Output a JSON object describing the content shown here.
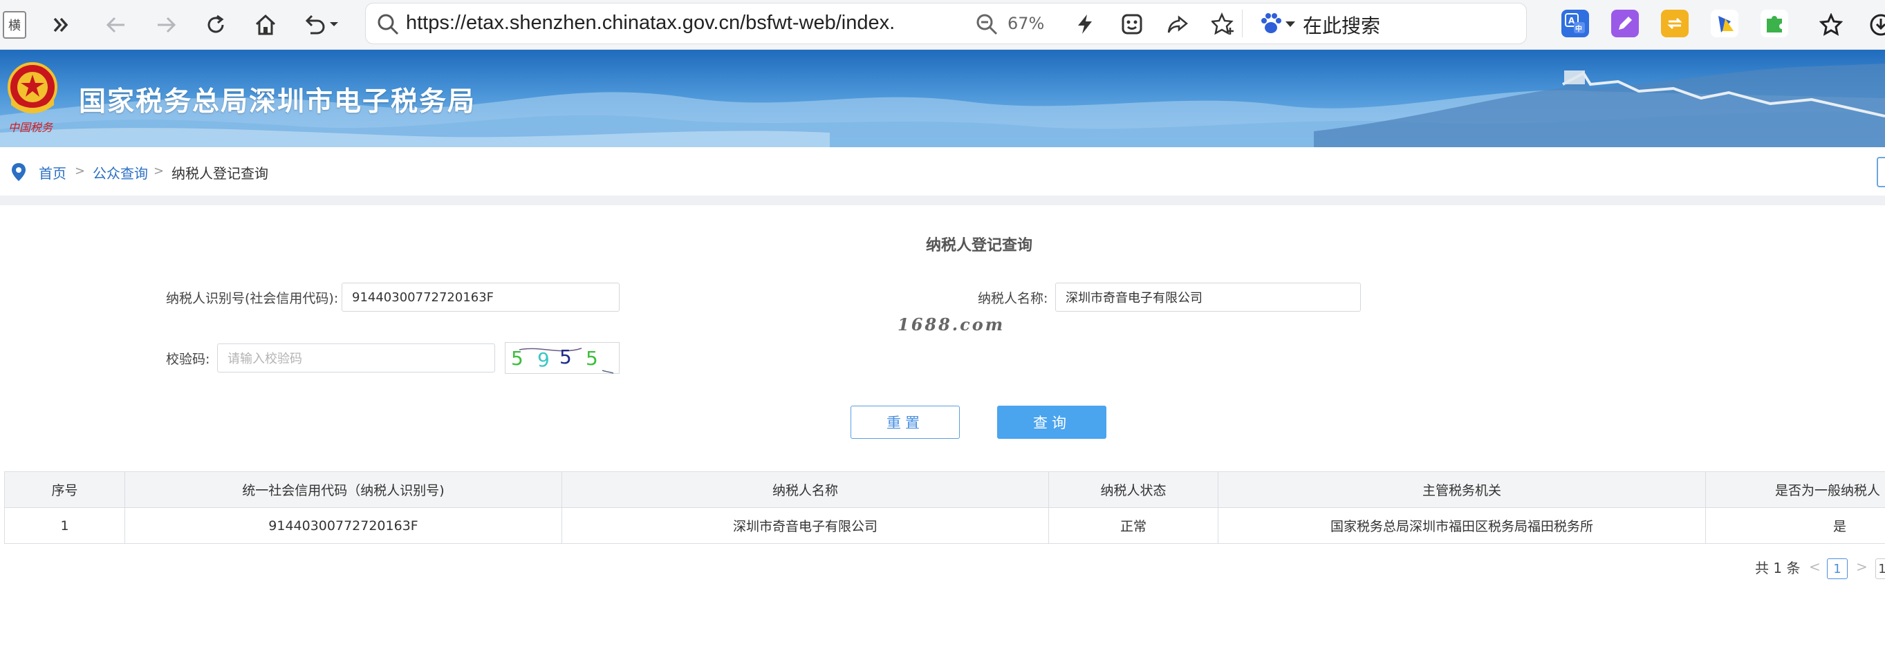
{
  "browser": {
    "tab_mark": "横",
    "url": "https://etax.shenzhen.chinatax.gov.cn/bsfwt-web/index.",
    "zoom": "67%",
    "search_engine_text": "在此搜索"
  },
  "banner": {
    "title": "国家税务总局深圳市电子税务局"
  },
  "breadcrumb": {
    "home": "首页",
    "sep": ">",
    "public_query": "公众查询",
    "current": "纳税人登记查询"
  },
  "form": {
    "title": "纳税人登记查询",
    "taxpayer_id_label": "纳税人识别号(社会信用代码):",
    "taxpayer_id_value": "91440300772720163F",
    "taxpayer_name_label": "纳税人名称:",
    "taxpayer_name_value": "深圳市奇音电子有限公司",
    "captcha_label": "校验码:",
    "captcha_placeholder": "请输入校验码",
    "captcha_chars": [
      "5",
      "9",
      "5",
      "5"
    ],
    "watermark": "1688.com",
    "reset_label": "重置",
    "query_label": "查询"
  },
  "table": {
    "headers": [
      "序号",
      "统一社会信用代码（纳税人识别号)",
      "纳税人名称",
      "纳税人状态",
      "主管税务机关",
      "是否为一般纳税人"
    ],
    "rows": [
      [
        "1",
        "91440300772720163F",
        "深圳市奇音电子有限公司",
        "正常",
        "国家税务总局深圳市福田区税务局福田税务所",
        "是"
      ]
    ]
  },
  "pagination": {
    "total": "共 1 条",
    "prev": "<",
    "current": "1",
    "next": ">",
    "edge": "1"
  }
}
